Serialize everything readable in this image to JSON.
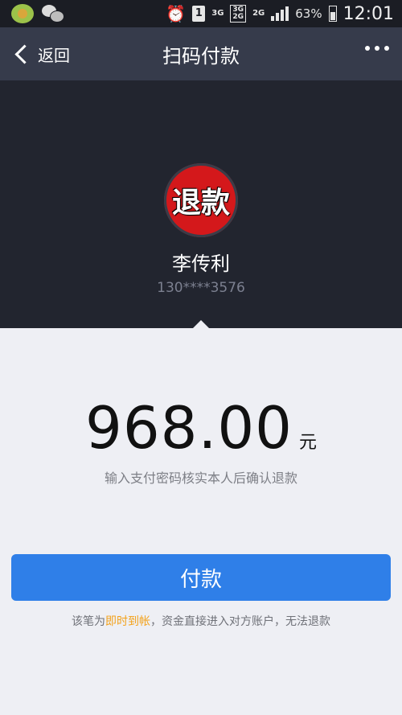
{
  "status_bar": {
    "sim_slot": "1",
    "network_1": "3G",
    "network_2a": "3G",
    "network_2b": "2G",
    "network_3": "2G",
    "battery_percent": "63%",
    "battery_level": 0.63,
    "time": "12:01"
  },
  "nav": {
    "back_label": "返回",
    "title": "扫码付款"
  },
  "payee": {
    "avatar_text": "退款",
    "name": "李传利",
    "account": "130****3576"
  },
  "payment": {
    "amount": "968.00",
    "unit": "元",
    "hint": "输入支付密码核实本人后确认退款",
    "button_label": "付款",
    "notice_prefix": "该笔为",
    "notice_highlight": "即时到帐",
    "notice_suffix": "，资金直接进入对方账户，无法退款"
  },
  "colors": {
    "primary_button": "#2f7fe8",
    "highlight_text": "#f3a21b",
    "avatar_red": "#d4181b"
  }
}
